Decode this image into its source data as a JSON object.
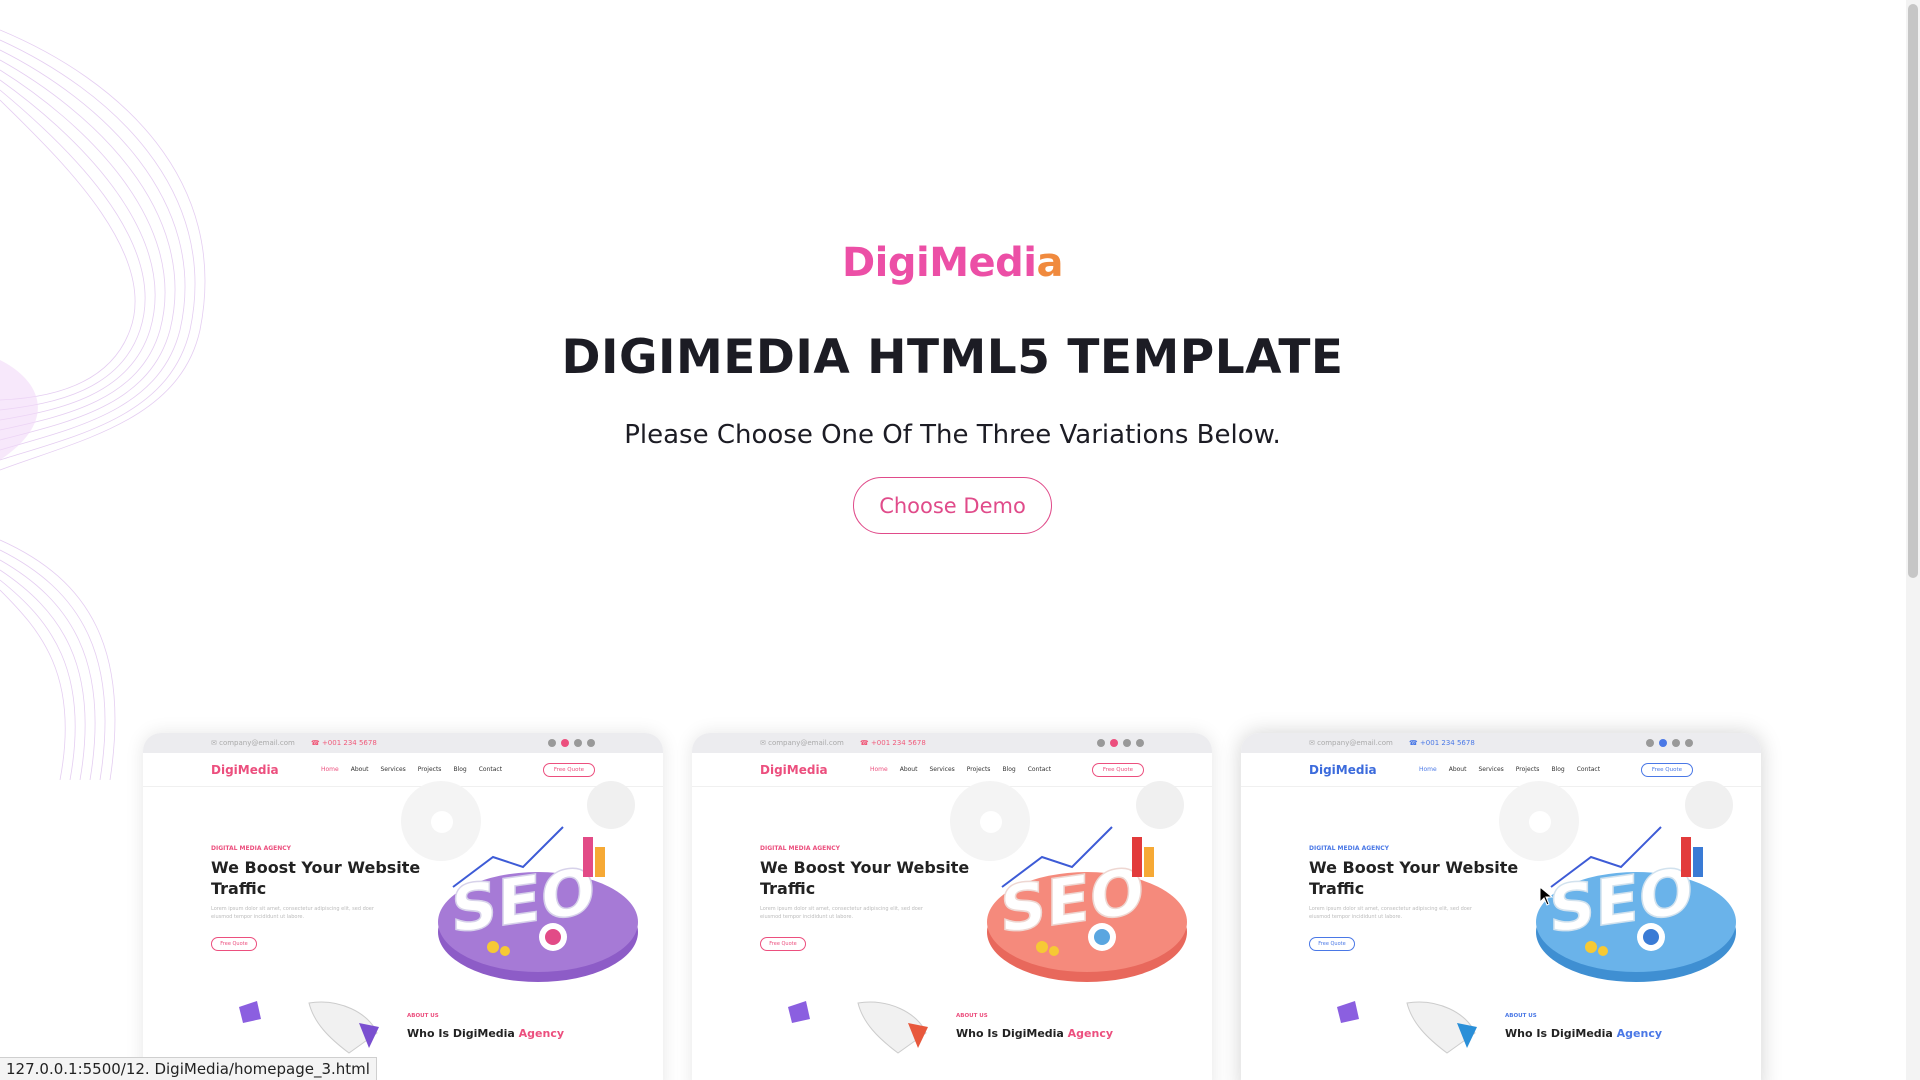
{
  "logo": {
    "part1": "DigiMedi",
    "part2": "a"
  },
  "title": "DIGIMEDIA HTML5 TEMPLATE",
  "subtitle": "Please Choose One Of The Three Variations Below.",
  "cta_label": "Choose Demo",
  "cards": [
    {
      "variant": "pink",
      "brand": "DigiMedia",
      "nav_links": [
        "Home",
        "About",
        "Services",
        "Projects",
        "Blog",
        "Contact"
      ],
      "quote_button": "Free Quote",
      "kicker": "DIGITAL MEDIA AGENCY",
      "headline": "We Boost Your Website Traffic",
      "lorem": "Lorem ipsum dolor sit amet, consectetur adipiscing elit, sed doer eiusmod tempor incididunt ut labore.",
      "about_tag": "ABOUT US",
      "about_title_main": "Who Is DigiMedia ",
      "about_title_highlight": "Agency",
      "accent": "#ec4f7e",
      "platform_color": "#8d5cc7"
    },
    {
      "variant": "coral",
      "brand": "DigiMedia",
      "nav_links": [
        "Home",
        "About",
        "Services",
        "Projects",
        "Blog",
        "Contact"
      ],
      "quote_button": "Free Quote",
      "kicker": "DIGITAL MEDIA AGENCY",
      "headline": "We Boost Your Website Traffic",
      "lorem": "Lorem ipsum dolor sit amet, consectetur adipiscing elit, sed doer eiusmod tempor incididunt ut labore.",
      "about_tag": "ABOUT US",
      "about_title_main": "Who Is DigiMedia ",
      "about_title_highlight": "Agency",
      "accent": "#ec4f7e",
      "platform_color": "#f07a6a"
    },
    {
      "variant": "blue",
      "brand": "DigiMedia",
      "nav_links": [
        "Home",
        "About",
        "Services",
        "Projects",
        "Blog",
        "Contact"
      ],
      "quote_button": "Free Quote",
      "kicker": "DIGITAL MEDIA AGENCY",
      "headline": "We Boost Your Website Traffic",
      "lorem": "Lorem ipsum dolor sit amet, consectetur adipiscing elit, sed doer eiusmod tempor incididunt ut labore.",
      "about_tag": "ABOUT US",
      "about_title_main": "Who Is DigiMedia ",
      "about_title_highlight": "Agency",
      "accent": "#4a78e6",
      "platform_color": "#5aa6e0"
    }
  ],
  "status_url": "127.0.0.1:5500/12. DigiMedia/homepage_3.html",
  "colors": {
    "pink": "#ec4fa6",
    "orange": "#f08a3e",
    "cta": "#e04b8a",
    "dark": "#1c1c24"
  },
  "icons": {
    "cursor": "mouse-pointer-icon"
  }
}
